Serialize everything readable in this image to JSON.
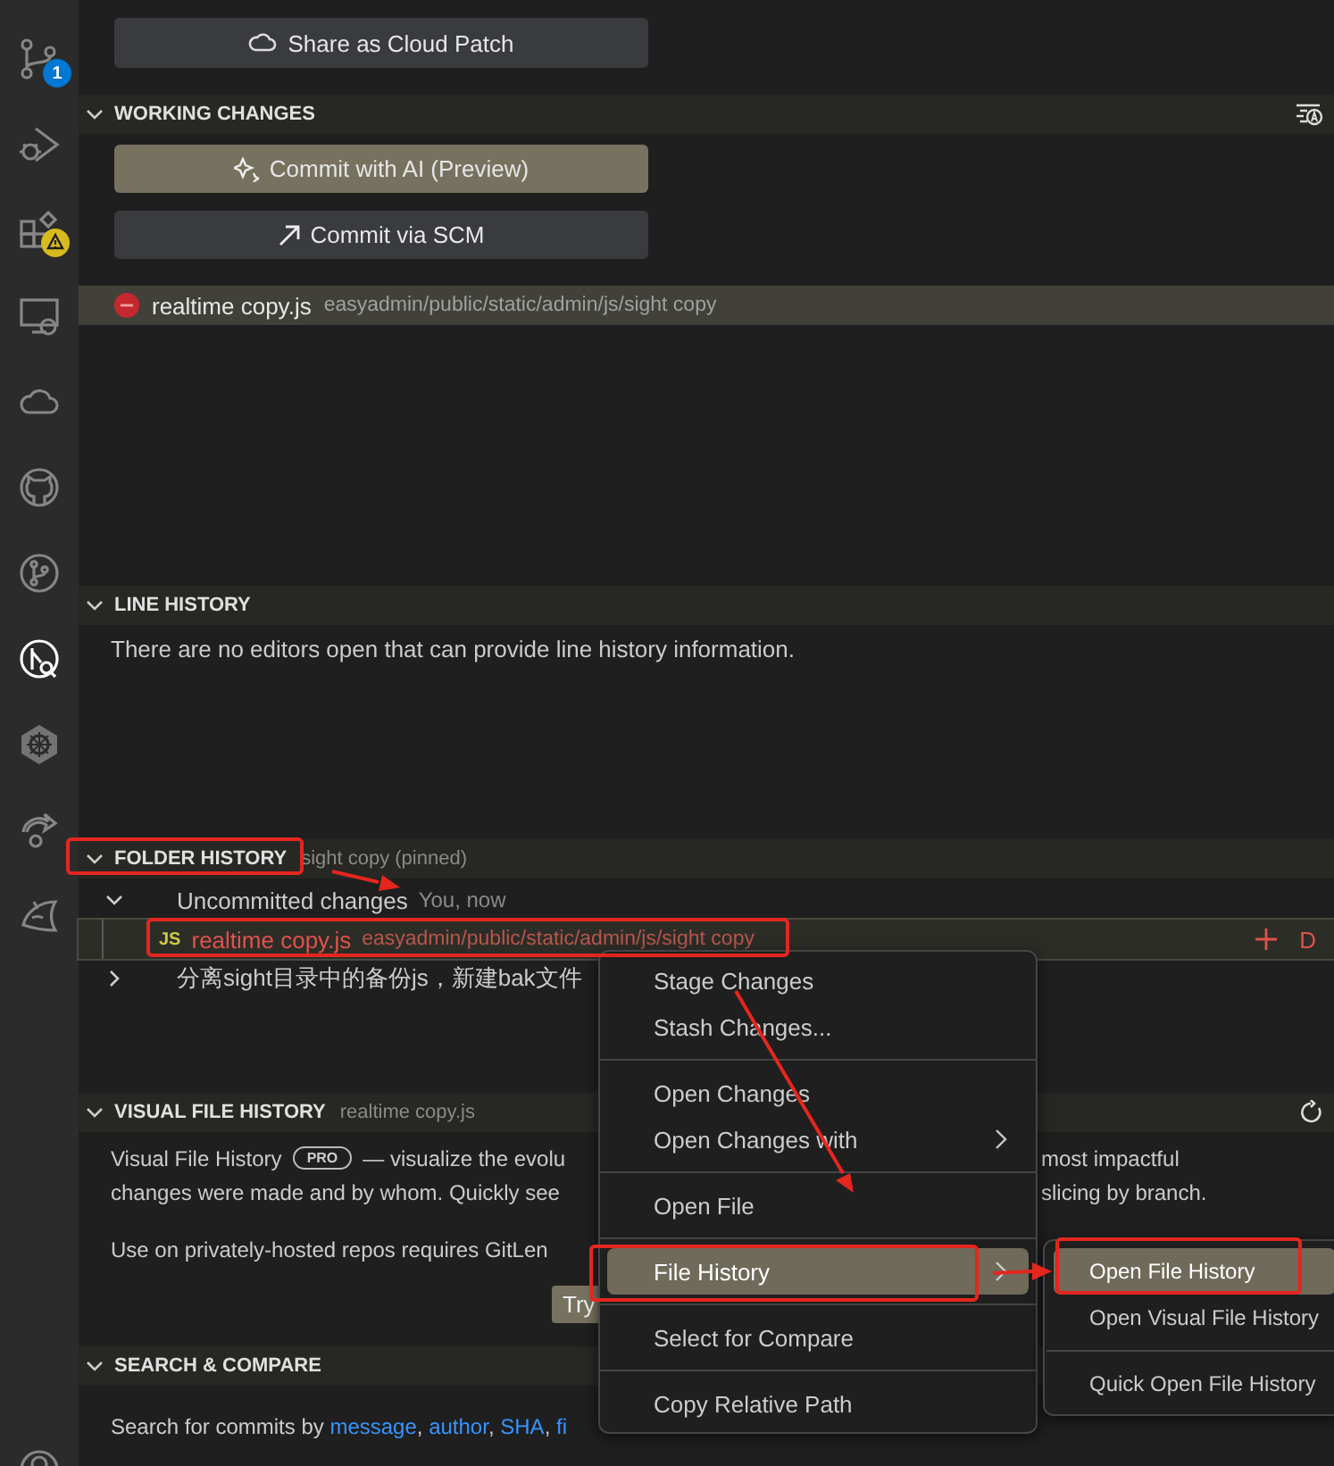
{
  "activity_bar": [
    {
      "kind": "source-control",
      "selected": false,
      "badge": "1"
    },
    {
      "kind": "run-debug",
      "selected": false
    },
    {
      "kind": "extensions",
      "selected": false,
      "warning": true
    },
    {
      "kind": "remote",
      "selected": false
    },
    {
      "kind": "cloud",
      "selected": false
    },
    {
      "kind": "github",
      "selected": false
    },
    {
      "kind": "branch",
      "selected": false
    },
    {
      "kind": "gitlens",
      "selected": true
    },
    {
      "kind": "helm",
      "selected": false
    },
    {
      "kind": "share",
      "selected": false
    },
    {
      "kind": "fish",
      "selected": false
    },
    {
      "kind": "account",
      "selected": false
    }
  ],
  "share_button": "Share as Cloud Patch",
  "working_changes": {
    "title": "WORKING CHANGES",
    "expanded": true,
    "buttons": [
      {
        "label": "Commit with AI (Preview)",
        "kind": "ai"
      },
      {
        "label": "Commit via SCM",
        "kind": "scm"
      }
    ],
    "files": [
      {
        "name": "realtime copy.js",
        "path": "easyadmin/public/static/admin/js/sight copy",
        "selected": true
      }
    ]
  },
  "line_history": {
    "title": "LINE HISTORY",
    "expanded": true,
    "message": "There are no editors open that can provide line history information."
  },
  "folder_history": {
    "title": "FOLDER HISTORY",
    "description": "sight copy (pinned)",
    "expanded": true,
    "rows": [
      {
        "kind": "group",
        "expanded": true,
        "label": "Uncommitted changes",
        "meta": "You, now"
      },
      {
        "kind": "file",
        "icon_text": "JS",
        "name": "realtime copy.js",
        "path": "easyadmin/public/static/admin/js/sight copy",
        "status": "D",
        "selected": true
      },
      {
        "kind": "commit",
        "expanded": false,
        "label": "分离sight目录中的备份js，新建bak文件"
      }
    ]
  },
  "visual_file_history": {
    "title": "VISUAL FILE HISTORY",
    "description": "realtime copy.js",
    "expanded": true,
    "line_1_left": "Visual File History",
    "badge": "PRO",
    "line_1_mid": "— visualize the evolu",
    "line_1_right": "most impactful",
    "line_2_left": "changes were made and by whom. Quickly see",
    "line_2_right": "slicing by branch.",
    "line_3": "Use on privately-hosted repos requires GitLen",
    "try_button": "Try"
  },
  "search_compare": {
    "title": "SEARCH & COMPARE",
    "expanded": true,
    "parts": [
      {
        "text": "Search for commits by ",
        "link": false
      },
      {
        "text": "message",
        "link": true
      },
      {
        "text": ", ",
        "link": false
      },
      {
        "text": "author",
        "link": true
      },
      {
        "text": ", ",
        "link": false
      },
      {
        "text": "SHA",
        "link": true
      },
      {
        "text": ", ",
        "link": false
      },
      {
        "text": "fi",
        "link": true
      }
    ]
  },
  "context_menu": {
    "groups": [
      [
        {
          "label": "Stage Changes",
          "selected": false,
          "submenu": false
        },
        {
          "label": "Stash Changes...",
          "selected": false,
          "submenu": false
        }
      ],
      [
        {
          "label": "Open Changes",
          "selected": false,
          "submenu": false
        },
        {
          "label": "Open Changes with",
          "selected": false,
          "submenu": true
        }
      ],
      [
        {
          "label": "Open File",
          "selected": false,
          "submenu": false
        }
      ],
      [
        {
          "label": "File History",
          "selected": true,
          "submenu": true
        }
      ],
      [
        {
          "label": "Select for Compare",
          "selected": false,
          "submenu": false
        }
      ],
      [
        {
          "label": "Copy Relative Path",
          "selected": false,
          "submenu": false
        }
      ]
    ]
  },
  "submenu": {
    "groups": [
      [
        {
          "label": "Open File History",
          "selected": true
        },
        {
          "label": "Open Visual File History",
          "selected": false
        }
      ],
      [
        {
          "label": "Quick Open File History",
          "selected": false
        }
      ]
    ]
  }
}
